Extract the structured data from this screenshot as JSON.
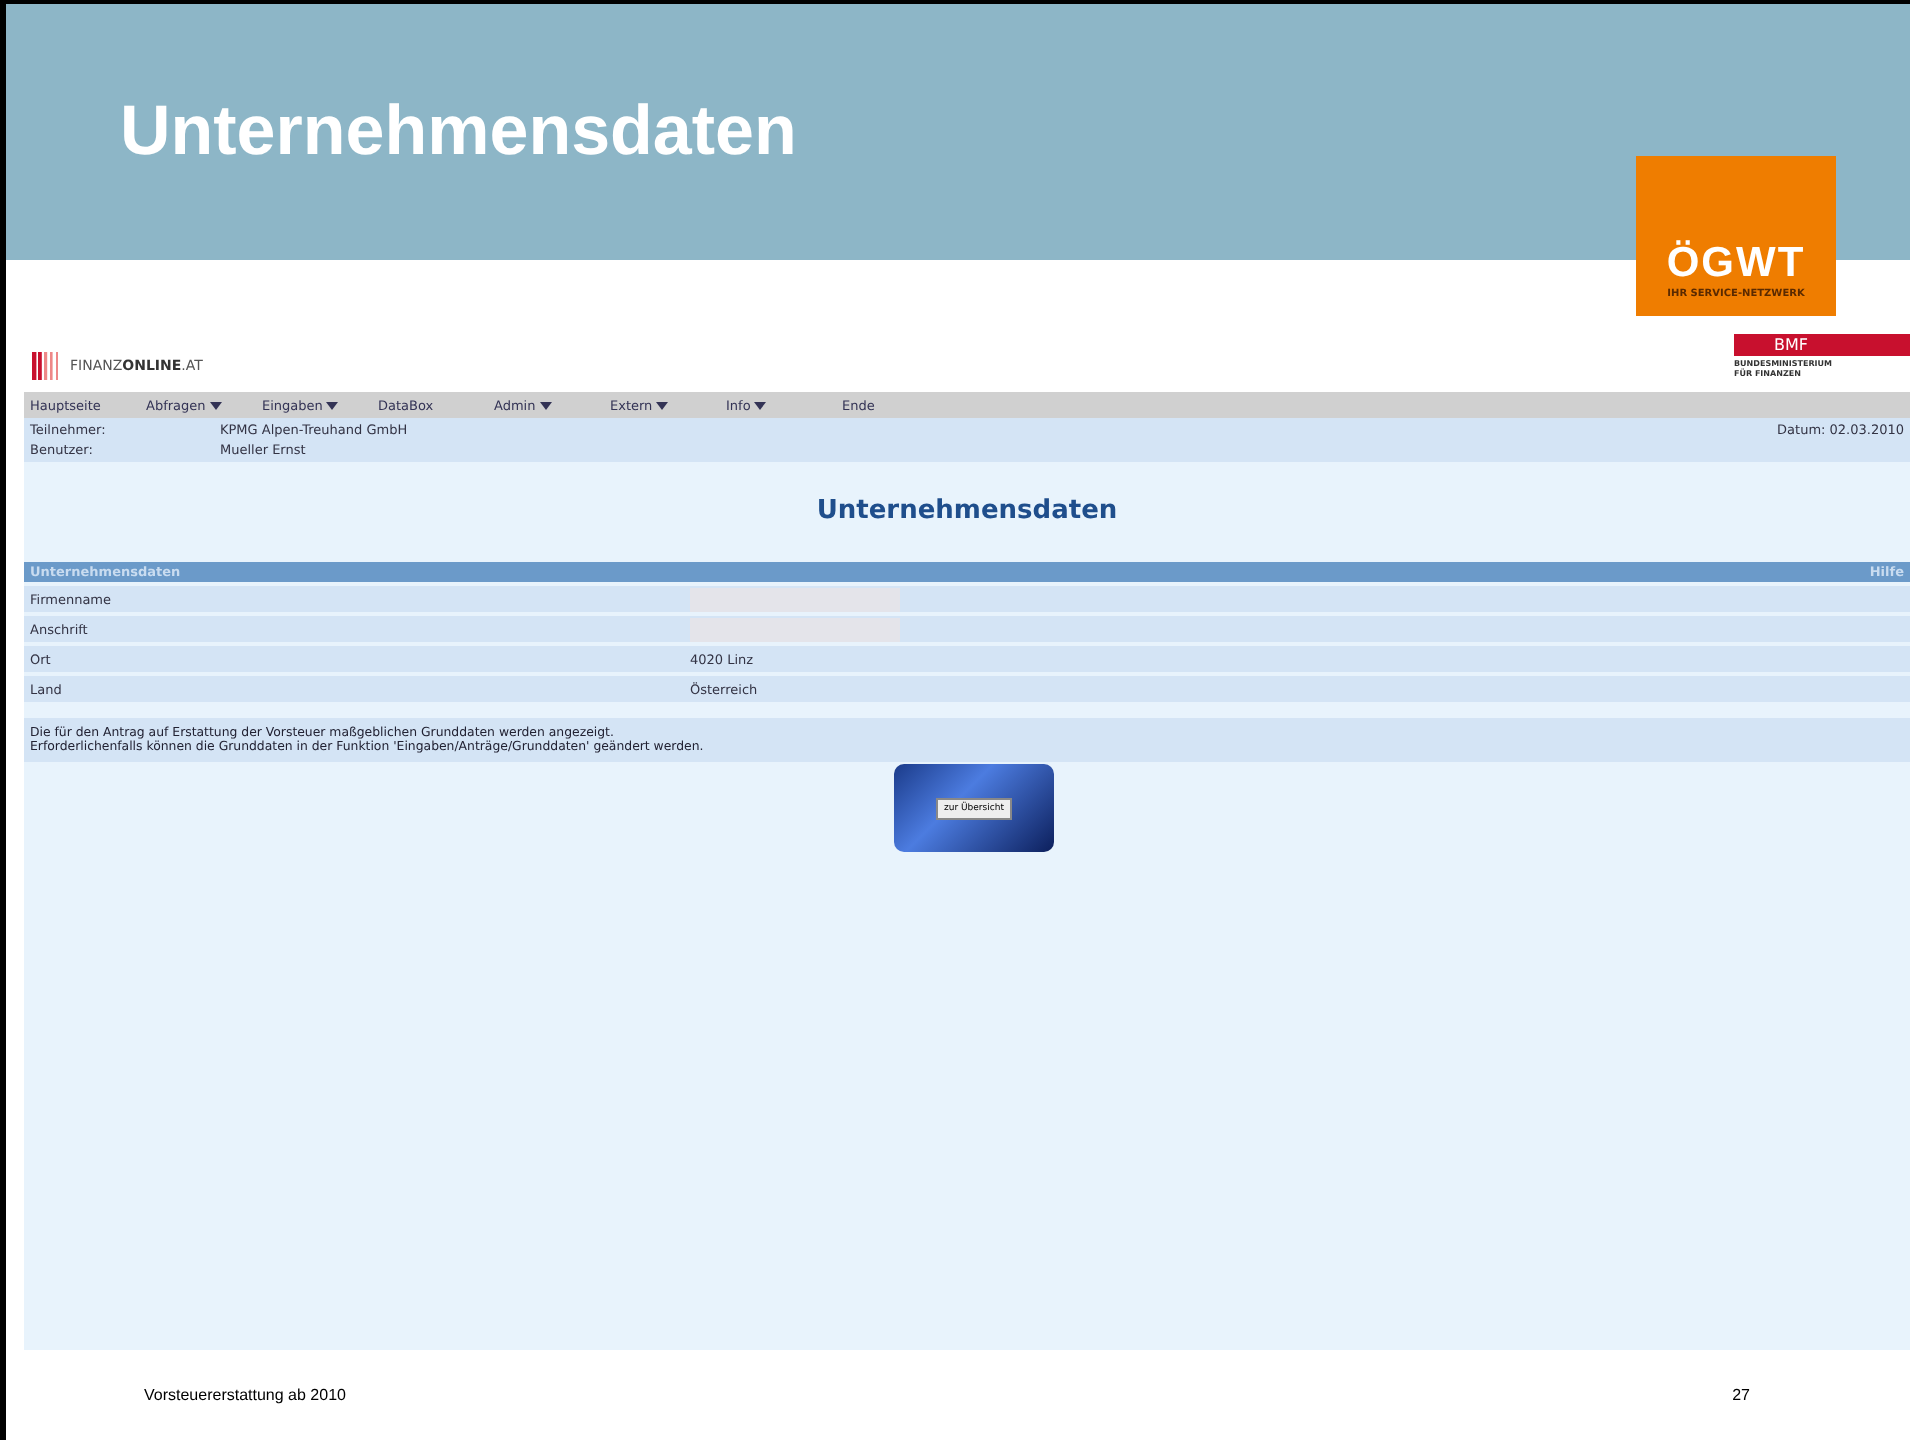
{
  "slide": {
    "title": "Unternehmensdaten",
    "footer_text": "Vorsteuererstattung ab 2010",
    "page_number": "27"
  },
  "logos": {
    "ogwt": {
      "name": "ÖGWT",
      "tagline": "IHR SERVICE-NETZWERK"
    },
    "finanzonline": {
      "light": "FINANZ",
      "bold": "ONLINE",
      "suffix": ".AT"
    },
    "bmf": {
      "name": "BMF",
      "subtitle": "BUNDESMINISTERIUM FÜR FINANZEN"
    }
  },
  "menu": [
    {
      "label": "Hauptseite",
      "has_menu": false
    },
    {
      "label": "Abfragen",
      "has_menu": true
    },
    {
      "label": "Eingaben",
      "has_menu": true
    },
    {
      "label": "DataBox",
      "has_menu": false
    },
    {
      "label": "Admin",
      "has_menu": true
    },
    {
      "label": "Extern",
      "has_menu": true
    },
    {
      "label": "Info",
      "has_menu": true
    },
    {
      "label": "Ende",
      "has_menu": false
    }
  ],
  "info": {
    "participant_label": "Teilnehmer:",
    "participant": "KPMG Alpen-Treuhand GmbH",
    "user_label": "Benutzer:",
    "user": "Mueller Ernst",
    "date": "Datum: 02.03.2010"
  },
  "page_heading": "Unternehmensdaten",
  "table": {
    "title": "Unternehmensdaten",
    "help": "Hilfe",
    "rows": [
      {
        "label": "Firmenname",
        "redacted": true
      },
      {
        "label": "Anschrift",
        "redacted": true
      },
      {
        "label": "Ort",
        "value": "4020 Linz",
        "redacted": false
      },
      {
        "label": "Land",
        "value": "Österreich",
        "redacted": false
      }
    ]
  },
  "note_lines": [
    "Die für den Antrag auf Erstattung der Vorsteuer maßgeblichen Grunddaten werden angezeigt.",
    "Erforderlichenfalls können die Grunddaten in der Funktion 'Eingaben/Anträge/Grunddaten' geändert werden."
  ],
  "overview_button": "zur Übersicht"
}
